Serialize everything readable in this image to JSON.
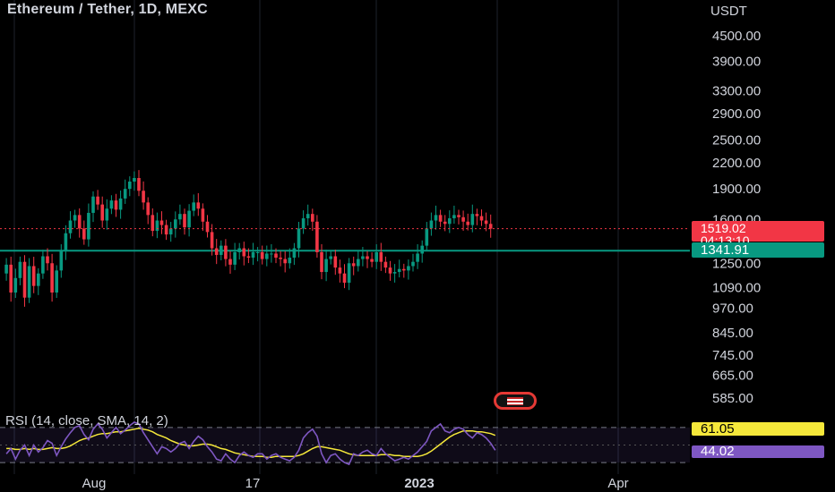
{
  "header": {
    "title": "Ethereum / Tether, 1D, MEXC"
  },
  "axis": {
    "unit": "USDT"
  },
  "badges": {
    "last_price": "1519.02",
    "countdown": "04:13:10",
    "hline_price": "1341.91",
    "rsi_value": "44.02",
    "rsi_ma_value": "61.05"
  },
  "rsi": {
    "label": "RSI (14, close, SMA, 14, 2)"
  },
  "colors": {
    "up": "#089981",
    "down": "#f23645",
    "hline": "#089981",
    "rsi": "#7e57c2",
    "rsi_ma": "#f5e83a",
    "grid": "#1e222d"
  },
  "chart_data": {
    "type": "candlestick",
    "title": "Ethereum / Tether, 1D, MEXC",
    "y_unit": "USDT",
    "y_scale": "log",
    "y_ticks": [
      585,
      665,
      745,
      845,
      970,
      1090,
      1250,
      1600,
      1900,
      2200,
      2500,
      2900,
      3300,
      3900,
      4500
    ],
    "x_ticks": [
      "Aug",
      "17",
      "2023",
      "Apr"
    ],
    "last_price": 1519.02,
    "horizontal_line": 1341.91,
    "price_path": [
      1180,
      1240,
      1060,
      1150,
      1260,
      1030,
      1230,
      1100,
      1180,
      1300,
      1250,
      1060,
      1200,
      1340,
      1480,
      1590,
      1640,
      1520,
      1430,
      1660,
      1820,
      1740,
      1590,
      1700,
      1780,
      1690,
      1800,
      1900,
      1980,
      2020,
      1880,
      1760,
      1640,
      1500,
      1590,
      1550,
      1470,
      1520,
      1600,
      1650,
      1530,
      1680,
      1760,
      1700,
      1580,
      1490,
      1360,
      1310,
      1380,
      1280,
      1240,
      1330,
      1360,
      1300,
      1290,
      1330,
      1330,
      1280,
      1320,
      1320,
      1290,
      1280,
      1250,
      1290,
      1360,
      1520,
      1610,
      1650,
      1580,
      1330,
      1190,
      1280,
      1300,
      1220,
      1180,
      1120,
      1250,
      1230,
      1280,
      1300,
      1280,
      1260,
      1330,
      1260,
      1220,
      1180,
      1190,
      1210,
      1200,
      1230,
      1260,
      1320,
      1380,
      1520,
      1590,
      1640,
      1580,
      1560,
      1610,
      1640,
      1620,
      1580,
      1550,
      1650,
      1630,
      1590,
      1560,
      1519
    ],
    "rsi_series": [
      {
        "name": "RSI",
        "values": [
          40,
          46,
          34,
          44,
          50,
          38,
          50,
          42,
          47,
          55,
          52,
          38,
          48,
          57,
          64,
          70,
          72,
          62,
          56,
          68,
          74,
          68,
          58,
          64,
          70,
          63,
          67,
          72,
          76,
          74,
          64,
          56,
          48,
          40,
          48,
          46,
          42,
          46,
          52,
          54,
          46,
          54,
          60,
          56,
          48,
          42,
          34,
          32,
          40,
          34,
          30,
          38,
          42,
          38,
          36,
          40,
          40,
          34,
          38,
          40,
          36,
          34,
          32,
          36,
          44,
          58,
          64,
          68,
          60,
          40,
          30,
          38,
          40,
          34,
          30,
          28,
          40,
          38,
          42,
          44,
          40,
          38,
          46,
          40,
          36,
          32,
          34,
          36,
          34,
          38,
          42,
          48,
          54,
          66,
          70,
          74,
          66,
          64,
          68,
          70,
          68,
          62,
          58,
          64,
          62,
          58,
          52,
          44
        ]
      },
      {
        "name": "SMA",
        "values": [
          46,
          46,
          45,
          45,
          46,
          45,
          46,
          45,
          45,
          46,
          47,
          46,
          46,
          47,
          49,
          52,
          55,
          57,
          58,
          60,
          62,
          63,
          63,
          64,
          65,
          65,
          66,
          67,
          68,
          69,
          68,
          67,
          65,
          62,
          60,
          58,
          55,
          53,
          51,
          50,
          49,
          49,
          50,
          51,
          51,
          50,
          48,
          46,
          45,
          43,
          41,
          40,
          39,
          38,
          37,
          37,
          37,
          36,
          36,
          37,
          37,
          37,
          37,
          37,
          38,
          40,
          43,
          46,
          48,
          48,
          47,
          46,
          45,
          44,
          42,
          40,
          39,
          38,
          38,
          38,
          38,
          38,
          39,
          39,
          39,
          38,
          38,
          37,
          37,
          37,
          37,
          38,
          40,
          43,
          47,
          51,
          55,
          59,
          62,
          64,
          66,
          66,
          66,
          65,
          65,
          64,
          63,
          61
        ]
      }
    ]
  }
}
